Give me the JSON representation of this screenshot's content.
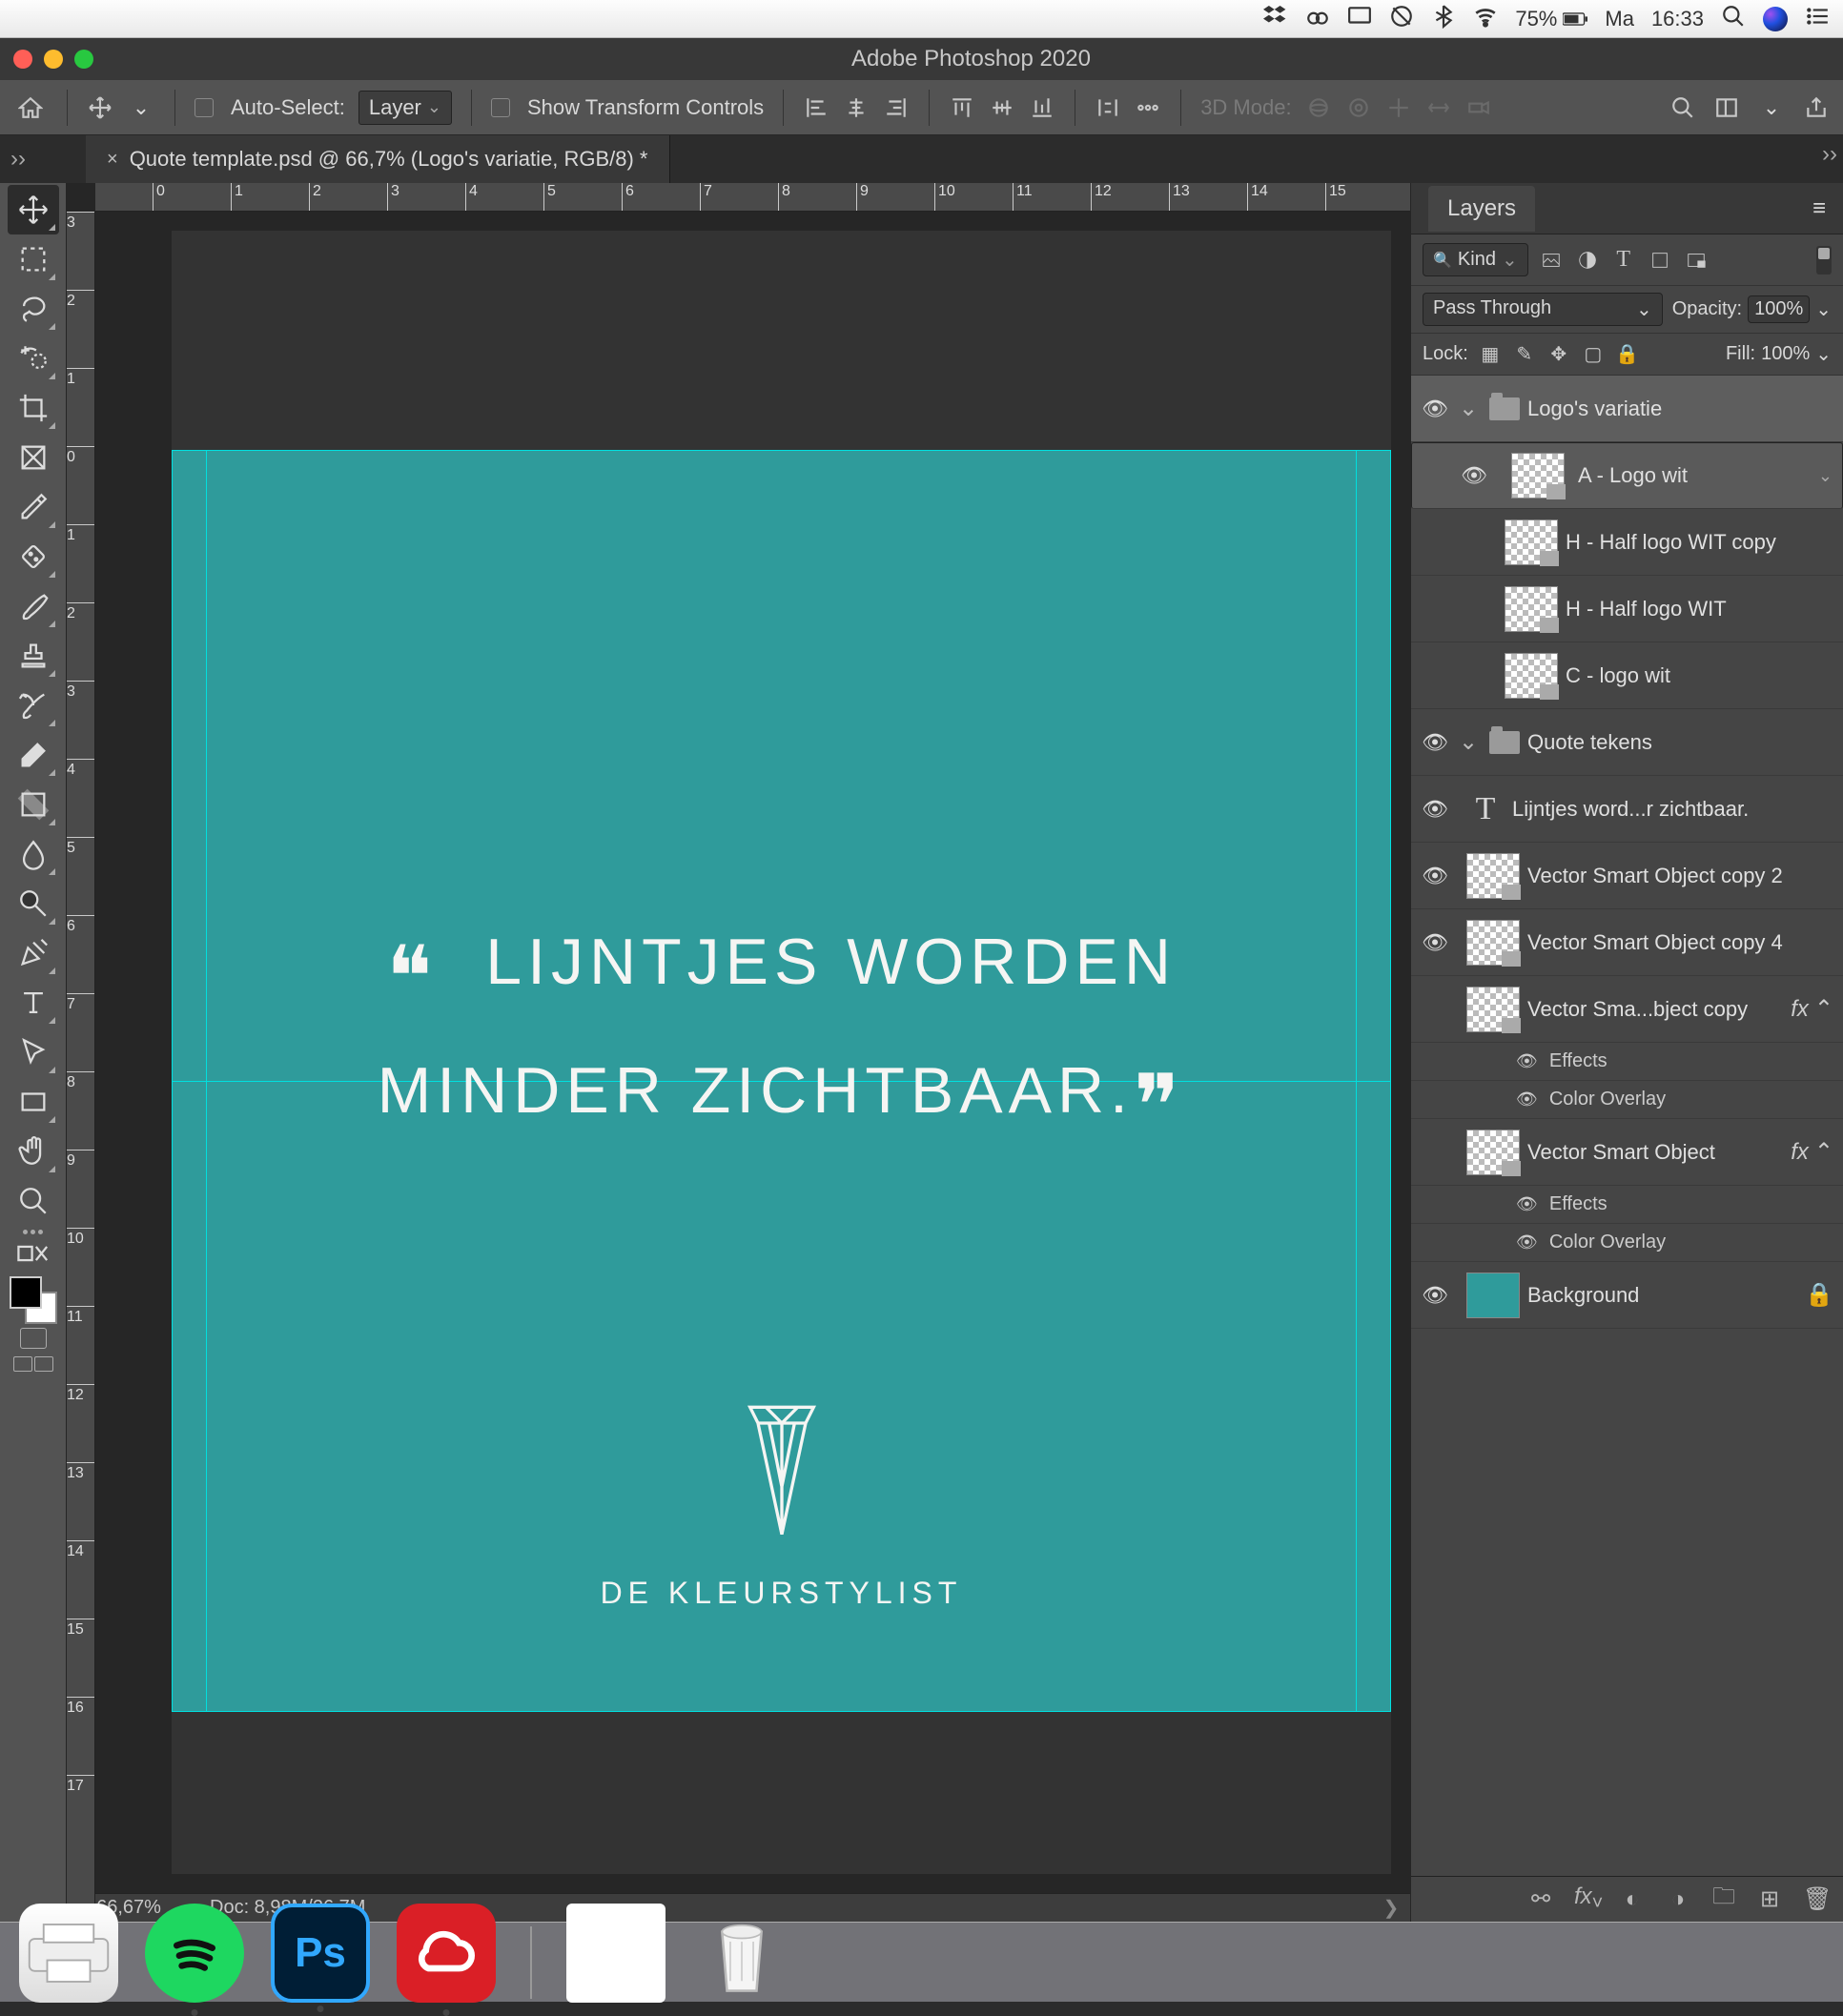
{
  "menubar": {
    "battery": "75%",
    "day": "Ma",
    "time": "16:33"
  },
  "window": {
    "title": "Adobe Photoshop 2020"
  },
  "options": {
    "auto_select": "Auto-Select:",
    "layer_sel": "Layer",
    "show_tf": "Show Transform Controls",
    "mode3d": "3D Mode:"
  },
  "doc_tab": "Quote template.psd @ 66,7% (Logo's variatie, RGB/8) *",
  "layers": {
    "title": "Layers",
    "kind": "Kind",
    "blend": "Pass Through",
    "opacity_label": "Opacity:",
    "opacity": "100%",
    "lock": "Lock:",
    "fill_label": "Fill:",
    "fill": "100%",
    "items": [
      {
        "type": "group",
        "name": "Logo's variatie",
        "visible": true,
        "open": true,
        "selected": true
      },
      {
        "type": "smart",
        "name": "A - Logo wit",
        "visible": true,
        "indent": 1,
        "selected": true
      },
      {
        "type": "smart",
        "name": "H - Half logo WIT copy",
        "visible": false,
        "indent": 1
      },
      {
        "type": "smart",
        "name": "H - Half logo WIT",
        "visible": false,
        "indent": 1
      },
      {
        "type": "smart",
        "name": "C - logo wit",
        "visible": false,
        "indent": 1
      },
      {
        "type": "group",
        "name": "Quote tekens",
        "visible": true,
        "open": true
      },
      {
        "type": "text",
        "name": "Lijntjes word...r zichtbaar.",
        "visible": true
      },
      {
        "type": "smart",
        "name": "Vector Smart Object copy 2",
        "visible": true
      },
      {
        "type": "smart",
        "name": "Vector Smart Object copy 4",
        "visible": true
      },
      {
        "type": "smart",
        "name": "Vector Sma...bject copy",
        "visible": false,
        "fx": true
      },
      {
        "type": "fx",
        "name": "Effects"
      },
      {
        "type": "fx",
        "name": "Color Overlay"
      },
      {
        "type": "smart",
        "name": "Vector Smart Object",
        "visible": false,
        "fx": true
      },
      {
        "type": "fx",
        "name": "Effects"
      },
      {
        "type": "fx",
        "name": "Color Overlay"
      },
      {
        "type": "bg",
        "name": "Background",
        "visible": true,
        "locked": true
      }
    ]
  },
  "canvas": {
    "quote_l1": "LIJNTJES WORDEN",
    "quote_l2": "MINDER ZICHTBAAR.",
    "brand": "DE KLEURSTYLIST"
  },
  "status": {
    "zoom": "66,67%",
    "doc": "Doc: 8,98M/26,7M"
  },
  "ruler_h": [
    "0",
    "1",
    "2",
    "3",
    "4",
    "5",
    "6",
    "7",
    "8",
    "9",
    "10",
    "11",
    "12",
    "13",
    "14",
    "15"
  ],
  "ruler_v": [
    "3",
    "2",
    "1",
    "0",
    "1",
    "2",
    "3",
    "4",
    "5",
    "6",
    "7",
    "8",
    "9",
    "10",
    "11",
    "12",
    "13",
    "14",
    "15",
    "16",
    "17"
  ]
}
